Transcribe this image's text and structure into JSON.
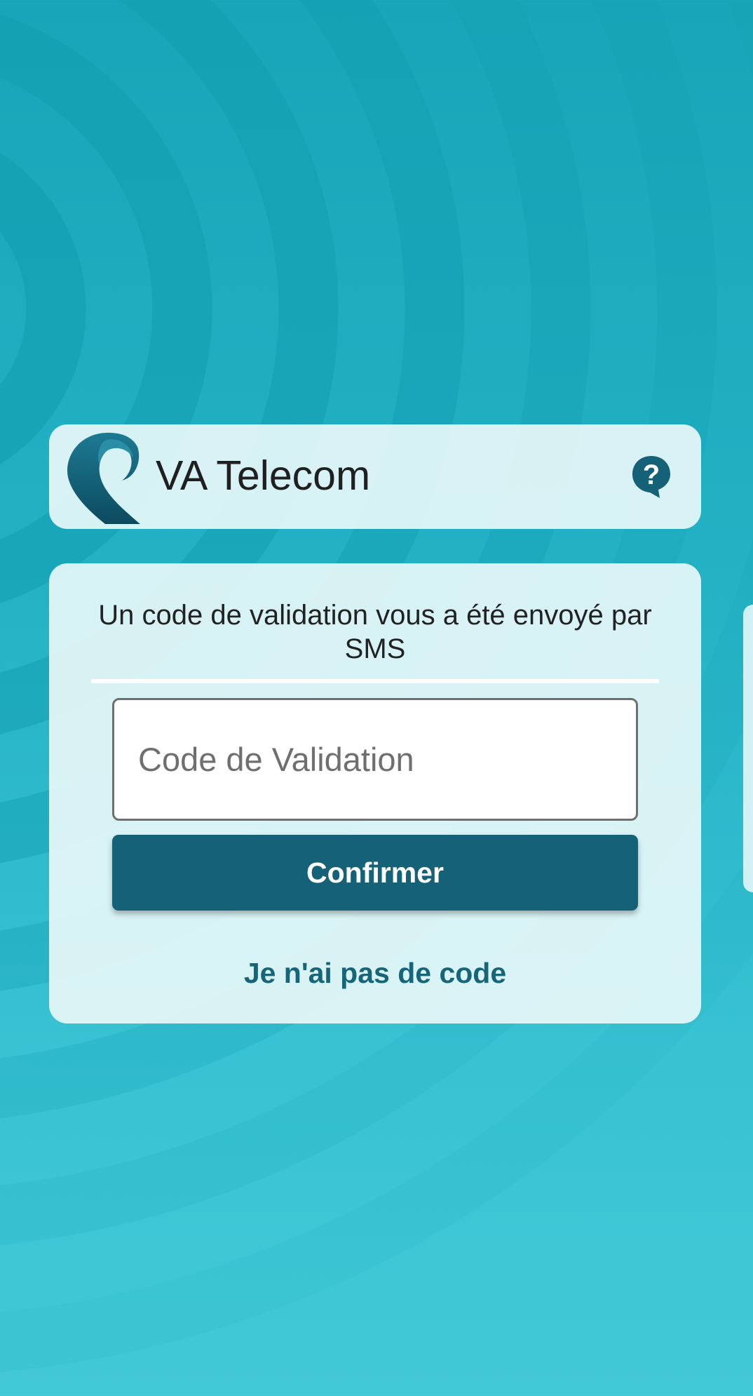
{
  "header": {
    "app_name": "VA Telecom",
    "logo_icon": "va-telecom-logo",
    "help_icon": "help-question-icon"
  },
  "form": {
    "message": "Un code de validation vous a été envoyé par SMS",
    "code_input": {
      "value": "",
      "placeholder": "Code de Validation"
    },
    "confirm_label": "Confirmer",
    "no_code_label": "Je n'ai pas de code"
  },
  "colors": {
    "primary": "#156178",
    "link": "#176579",
    "background": "#23b1c4",
    "card": "#e6f7f9"
  }
}
